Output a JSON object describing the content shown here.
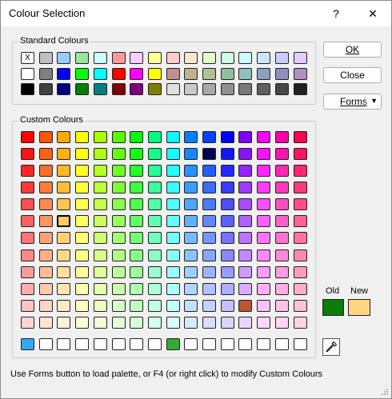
{
  "window": {
    "title": "Colour Selection",
    "help_glyph": "?",
    "close_glyph": "✕"
  },
  "standard": {
    "label": "Standard Colours",
    "selected_mark": "X",
    "colors": [
      [
        "#ffffff",
        "#c0c0c0",
        "#99ccff",
        "#99e699",
        "#ccffff",
        "#ff9999",
        "#ffccff",
        "#ffff99",
        "#ffcccc",
        "#ffe5cc",
        "#e5ffcc",
        "#ccffe5",
        "#ccffff",
        "#cce5ff",
        "#ccccff",
        "#e5ccff"
      ],
      [
        "#ffffff",
        "#808080",
        "#0000ff",
        "#00ff00",
        "#00ffff",
        "#ff0000",
        "#ff00ff",
        "#ffff00",
        "#c09090",
        "#c0b090",
        "#b0c090",
        "#90c0a0",
        "#90c0c0",
        "#90a0c0",
        "#9090c0",
        "#b090c0"
      ],
      [
        "#000000",
        "#404040",
        "#000080",
        "#008000",
        "#008080",
        "#800000",
        "#800080",
        "#808000",
        "#e0e0e0",
        "#c8c8c8",
        "#a8a8a8",
        "#909090",
        "#787878",
        "#606060",
        "#484848",
        "#202020"
      ]
    ]
  },
  "custom": {
    "label": "Custom Colours",
    "bottom_row": [
      "#33aaee",
      "#ffffff",
      "#ffffff",
      "#ffffff",
      "#ffffff",
      "#ffffff",
      "#ffffff",
      "#ffffff",
      "#33aa33",
      "#ffffff",
      "#ffffff",
      "#ffffff",
      "#ffffff",
      "#ffffff",
      "#ffffff",
      "#ffffff"
    ],
    "special_cell": {
      "row": 10,
      "col": 12,
      "color": "#bb5533"
    },
    "selected_cell": {
      "row": 5,
      "col": 2
    }
  },
  "buttons": {
    "ok_label": "OK",
    "close_label": "Close",
    "forms_label": "Forms",
    "forms_caret": "▼"
  },
  "compare": {
    "old_label": "Old",
    "new_label": "New",
    "old_color": "#0b7d0b",
    "new_color": "#ffd580"
  },
  "picker_icon": "eyedropper-icon",
  "status": "Use Forms button to load palette, or F4 (or right click) to modify Custom Colours"
}
